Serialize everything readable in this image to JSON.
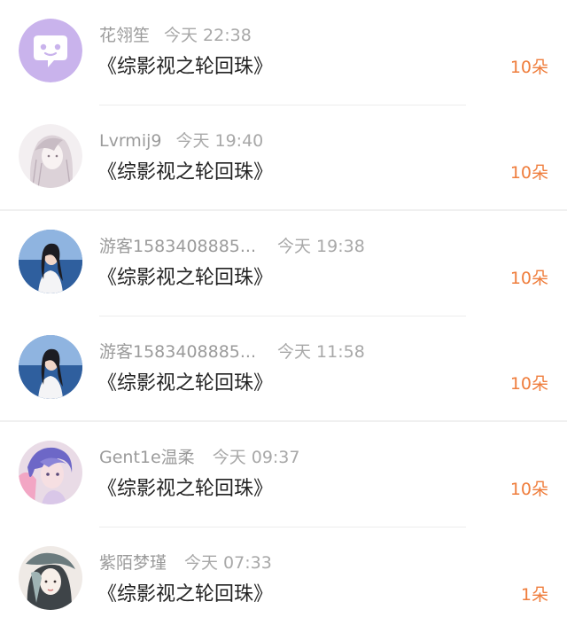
{
  "colors": {
    "accent": "#ef7d3c",
    "name_text": "#9b9b9b",
    "title_text": "#222222"
  },
  "records": [
    {
      "name": "花翎笙",
      "time": "今天 22:38",
      "book": "《综影视之轮回珠》",
      "amount": "10朵",
      "avatar_icon": "chat-bubble-avatar-icon"
    },
    {
      "name": "Lvrmij9",
      "time": "今天 19:40",
      "book": "《综影视之轮回珠》",
      "amount": "10朵",
      "avatar_icon": "sketch-girl-avatar-icon"
    },
    {
      "name": "游客1583408885...",
      "time": "今天 19:38",
      "book": "《综影视之轮回珠》",
      "amount": "10朵",
      "avatar_icon": "sea-portrait-avatar-icon"
    },
    {
      "name": "游客1583408885...",
      "time": "今天 11:58",
      "book": "《综影视之轮回珠》",
      "amount": "10朵",
      "avatar_icon": "sea-portrait-avatar-icon"
    },
    {
      "name": "Gent1e温柔",
      "time": "今天 09:37",
      "book": "《综影视之轮回珠》",
      "amount": "10朵",
      "avatar_icon": "purple-hair-avatar-icon"
    },
    {
      "name": "紫陌梦瑾",
      "time": "今天 07:33",
      "book": "《综影视之轮回珠》",
      "amount": "1朵",
      "avatar_icon": "ink-portrait-avatar-icon"
    }
  ]
}
